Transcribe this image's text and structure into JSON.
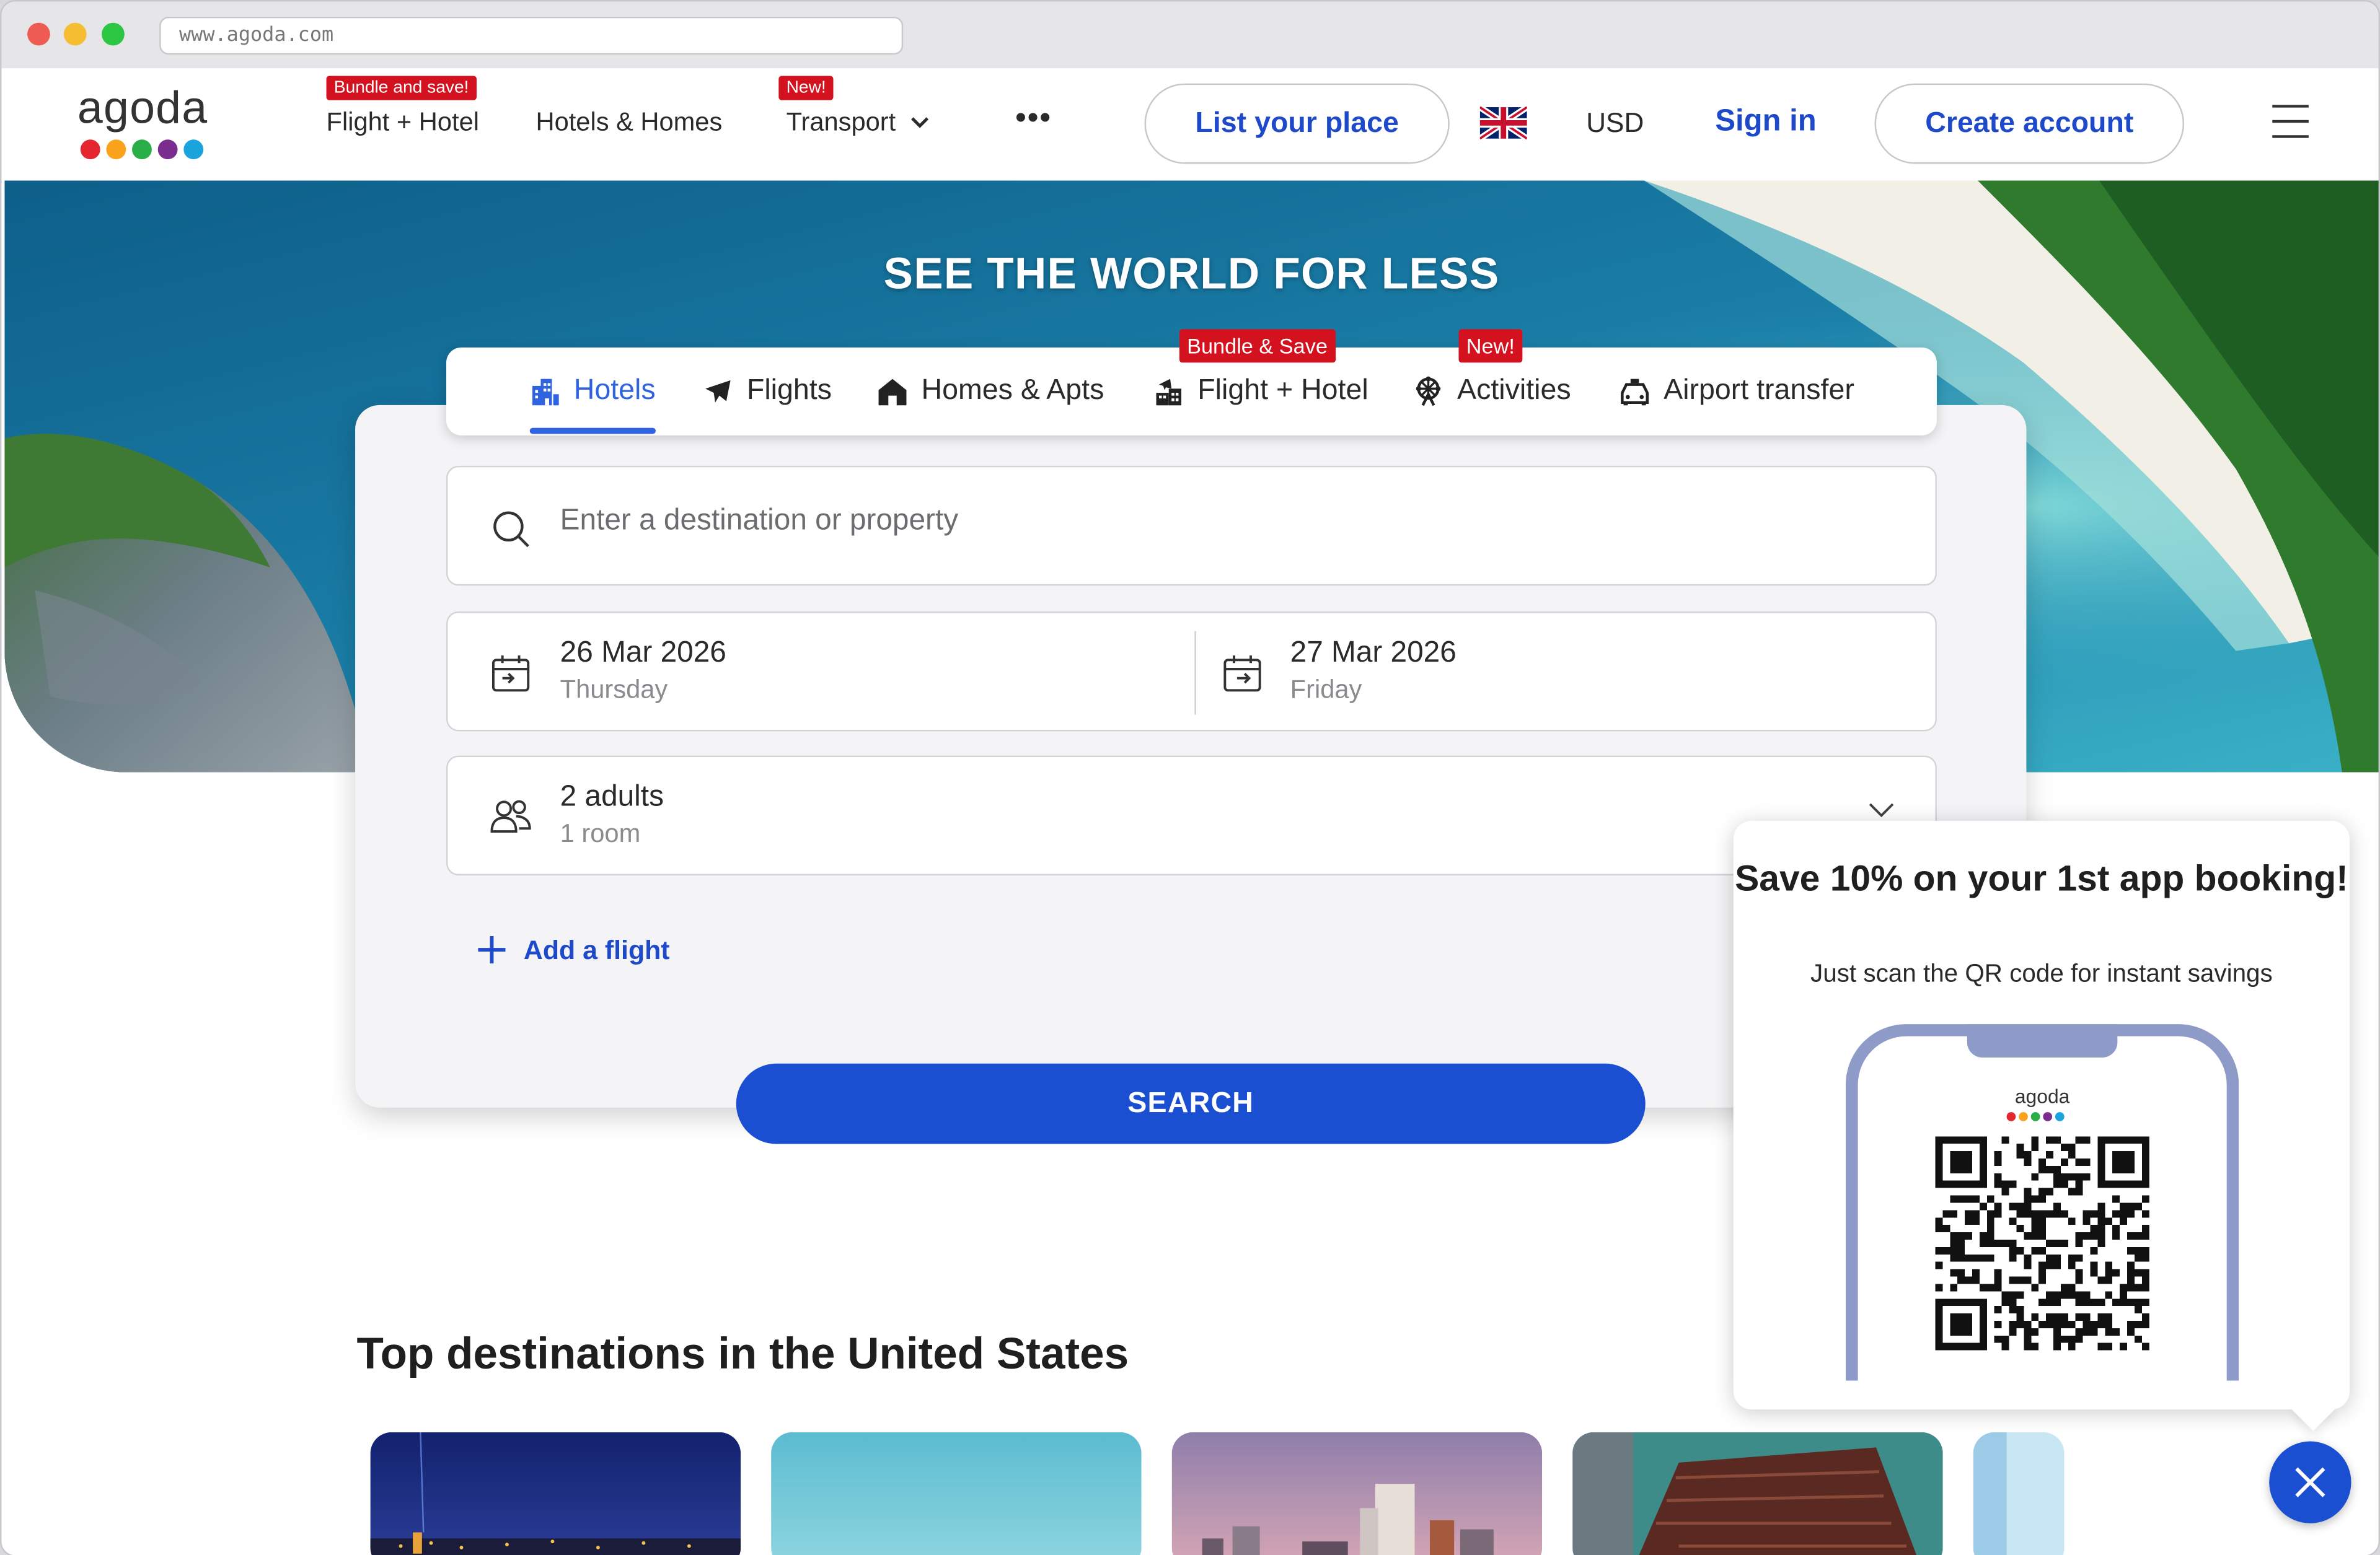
{
  "browser": {
    "url": "www.agoda.com",
    "traffic_colors": [
      "#ee5b52",
      "#f5bd32",
      "#2cc642"
    ]
  },
  "header": {
    "logo": "agoda",
    "logo_dot_colors": [
      "#e3262f",
      "#f9a21b",
      "#28ad47",
      "#7a2d8e",
      "#1ba3dd"
    ],
    "nav": [
      {
        "label": "Flight + Hotel",
        "badge": "Bundle and save!"
      },
      {
        "label": "Hotels & Homes",
        "badge": ""
      },
      {
        "label": "Transport",
        "badge": "New!"
      }
    ],
    "more": "•••",
    "list_your_place": "List your place",
    "currency": "USD",
    "sign_in": "Sign in",
    "create_account": "Create account"
  },
  "hero": {
    "title": "SEE THE WORLD FOR LESS"
  },
  "search": {
    "tabs": [
      {
        "label": "Hotels",
        "active": true
      },
      {
        "label": "Flights"
      },
      {
        "label": "Homes & Apts"
      },
      {
        "label": "Flight + Hotel",
        "badge": "Bundle & Save"
      },
      {
        "label": "Activities",
        "badge": "New!"
      },
      {
        "label": "Airport transfer"
      }
    ],
    "destination_placeholder": "Enter a destination or property",
    "checkin": {
      "date": "26 Mar 2026",
      "day": "Thursday"
    },
    "checkout": {
      "date": "27 Mar 2026",
      "day": "Friday"
    },
    "guests": {
      "adults": "2 adults",
      "rooms": "1 room"
    },
    "add_flight": "Add a flight",
    "search_button": "SEARCH"
  },
  "destinations": {
    "title": "Top destinations in the United States"
  },
  "popup": {
    "title": "Save 10% on your 1st app booking!",
    "subtitle": "Just scan the QR code for instant savings",
    "phone_logo": "agoda"
  },
  "colors": {
    "brand_blue": "#1b4fd1",
    "link_blue": "#1e49c8",
    "badge_red": "#d4111e"
  }
}
